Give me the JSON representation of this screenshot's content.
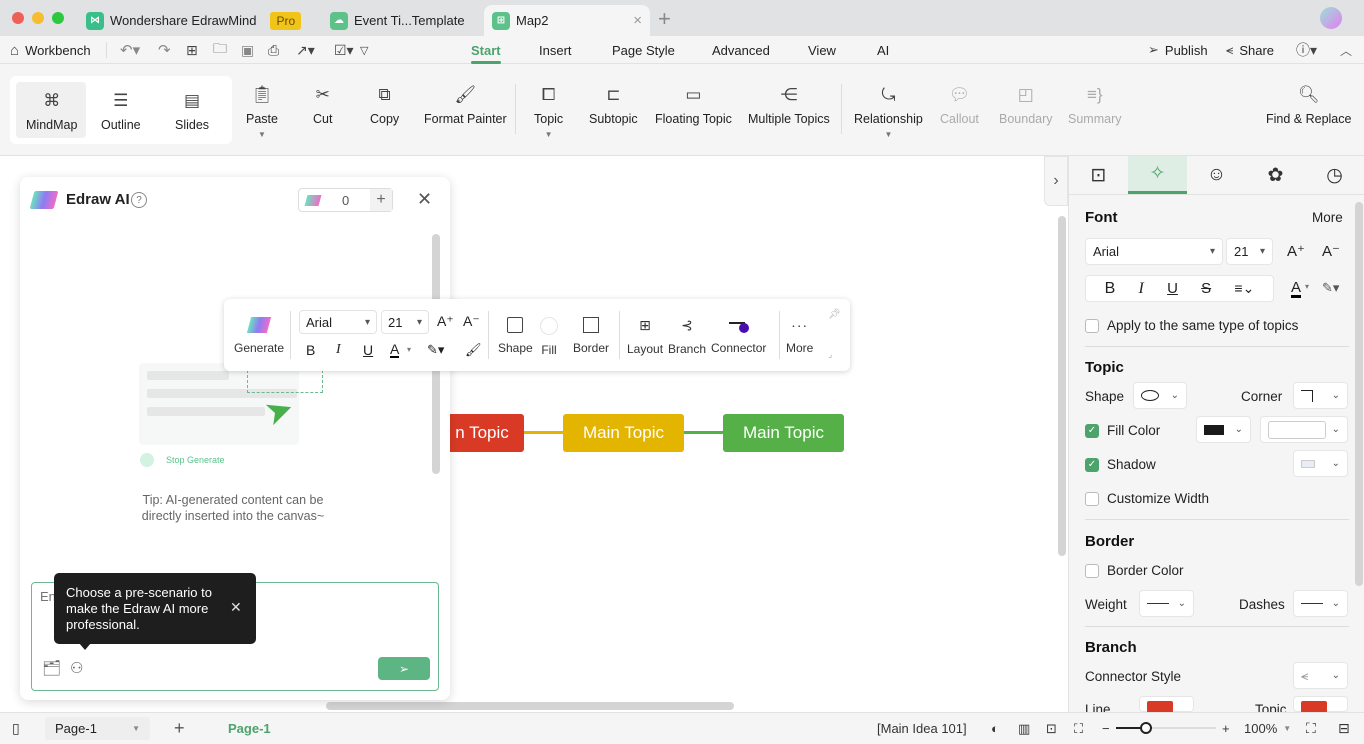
{
  "titlebar": {
    "tabs": [
      {
        "label": "Wondershare EdrawMind",
        "badge": "Pro"
      },
      {
        "label": "Event Ti...Template"
      },
      {
        "label": "Map2",
        "active": true
      }
    ],
    "close_glyph": "×",
    "new_tab_glyph": "+"
  },
  "menubar": {
    "workbench": "Workbench",
    "menus": [
      "Start",
      "Insert",
      "Page Style",
      "Advanced",
      "View",
      "AI"
    ],
    "active_menu": "Start",
    "publish": "Publish",
    "share": "Share"
  },
  "ribbon": {
    "views": [
      "MindMap",
      "Outline",
      "Slides"
    ],
    "active_view": "MindMap",
    "clipboard": [
      "Paste",
      "Cut",
      "Copy",
      "Format Painter"
    ],
    "insert": [
      "Topic",
      "Subtopic",
      "Floating Topic",
      "Multiple Topics"
    ],
    "relations": [
      "Relationship",
      "Callout",
      "Boundary",
      "Summary"
    ],
    "find": "Find & Replace"
  },
  "ai_panel": {
    "title": "Edraw AI",
    "credits": "0",
    "illustration_caption": "Stop Generate",
    "tip": "Tip: AI-generated content can be directly inserted into the canvas~",
    "input_placeholder": "Enter your question to Edraw AI",
    "tooltip": "Choose a pre-scenario to make the Edraw AI more professional."
  },
  "floating_toolbar": {
    "generate": "Generate",
    "font": "Arial",
    "size": "21",
    "buttons": [
      "Shape",
      "Fill",
      "Border",
      "Layout",
      "Branch",
      "Connector",
      "More"
    ],
    "connector_color": "#4b0fb0"
  },
  "canvas": {
    "topics": [
      {
        "label": "Main Topic",
        "visible_label": "n Topic",
        "color": "#d93a25"
      },
      {
        "label": "Main Topic",
        "color": "#e3b400"
      },
      {
        "label": "Main Topic",
        "color": "#55b047"
      }
    ],
    "connector_colors": [
      "#e3b400",
      "#55b047"
    ]
  },
  "right_panel": {
    "font_section": "Font",
    "more": "More",
    "font": "Arial",
    "size": "21",
    "apply_same": "Apply to the same type of topics",
    "topic_section": "Topic",
    "shape": "Shape",
    "corner": "Corner",
    "fill_color": "Fill Color",
    "fill_checked": true,
    "shadow": "Shadow",
    "shadow_checked": true,
    "customize_width": "Customize Width",
    "border_section": "Border",
    "border_color": "Border Color",
    "weight": "Weight",
    "dashes": "Dashes",
    "branch_section": "Branch",
    "connector_style": "Connector Style",
    "line": "Line",
    "topic": "Topic",
    "branch_color": "#d93a25"
  },
  "statusbar": {
    "page_select": "Page-1",
    "page_tab": "Page-1",
    "selection": "[Main Idea 101]",
    "zoom": "100%",
    "zoom_level": 0.3
  }
}
